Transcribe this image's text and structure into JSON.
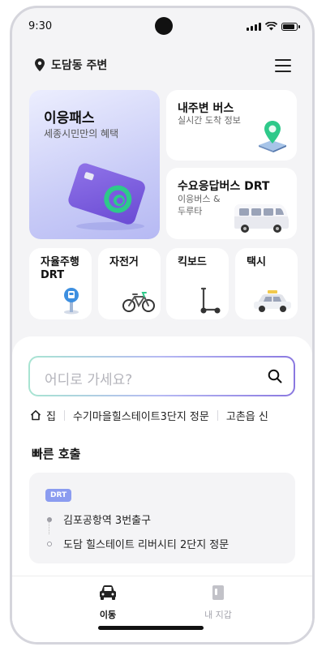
{
  "status_bar": {
    "time": "9:30"
  },
  "header": {
    "location": "도담동 주변"
  },
  "cards": {
    "pass": {
      "title": "이응패스",
      "subtitle": "세종시민만의 혜택"
    },
    "nearby_bus": {
      "title": "내주변 버스",
      "subtitle": "실시간 도착 정보"
    },
    "drt": {
      "title": "수요응답버스 DRT",
      "subtitle_line1": "이응버스 &",
      "subtitle_line2": "두루타"
    },
    "small": [
      {
        "title_line1": "자율주행",
        "title_line2": "DRT",
        "icon": "bus-stop-icon"
      },
      {
        "title_line1": "자전거",
        "title_line2": "",
        "icon": "bicycle-icon"
      },
      {
        "title_line1": "킥보드",
        "title_line2": "",
        "icon": "kickboard-icon"
      },
      {
        "title_line1": "택시",
        "title_line2": "",
        "icon": "taxi-icon"
      }
    ]
  },
  "search": {
    "placeholder": "어디로 가세요?"
  },
  "quick_places": {
    "home": "집",
    "items": [
      "수기마을힐스테이트3단지 정문",
      "고촌읍 신"
    ]
  },
  "fast_call": {
    "title": "빠른 호출",
    "badge": "DRT",
    "origin": "김포공항역 3번출구",
    "destination": "도담 힐스테이트 리버시티 2단지 정문"
  },
  "tabbar": {
    "tabs": [
      {
        "label": "이동",
        "active": true,
        "icon": "car-icon"
      },
      {
        "label": "내 지갑",
        "active": false,
        "icon": "wallet-icon"
      }
    ]
  },
  "colors": {
    "accent": "#8b9cf0",
    "pass_card": "#b6b9f3",
    "card_purple": "#7a5ae0",
    "card_green": "#2ec98a"
  }
}
